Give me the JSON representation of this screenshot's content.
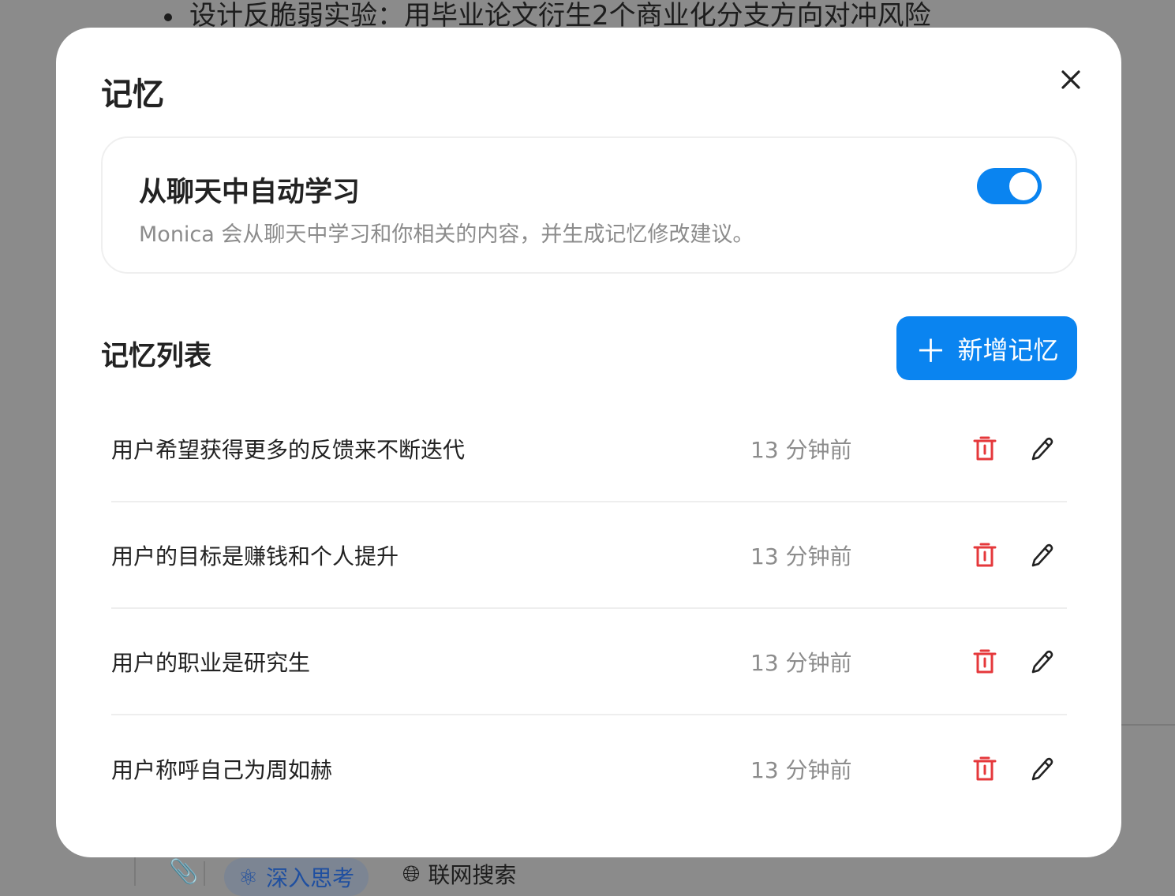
{
  "background": {
    "bullet_text": "设计反脆弱实验：用毕业论文衍生2个商业化分支方向对冲风险",
    "deep_think": "深入思考",
    "web_search": "联网搜索"
  },
  "modal": {
    "title": "记忆",
    "auto_learn": {
      "title": "从聊天中自动学习",
      "description": "Monica 会从聊天中学习和你相关的内容，并生成记忆修改建议。",
      "enabled": true
    },
    "list_title": "记忆列表",
    "add_button": "新增记忆",
    "items": [
      {
        "text": "用户希望获得更多的反馈来不断迭代",
        "time": "13 分钟前"
      },
      {
        "text": "用户的目标是赚钱和个人提升",
        "time": "13 分钟前"
      },
      {
        "text": "用户的职业是研究生",
        "time": "13 分钟前"
      },
      {
        "text": "用户称呼自己为周如赫",
        "time": "13 分钟前"
      }
    ]
  },
  "colors": {
    "accent": "#0a84f0",
    "delete": "#e5383b",
    "overlay": "#8b8b8b"
  }
}
